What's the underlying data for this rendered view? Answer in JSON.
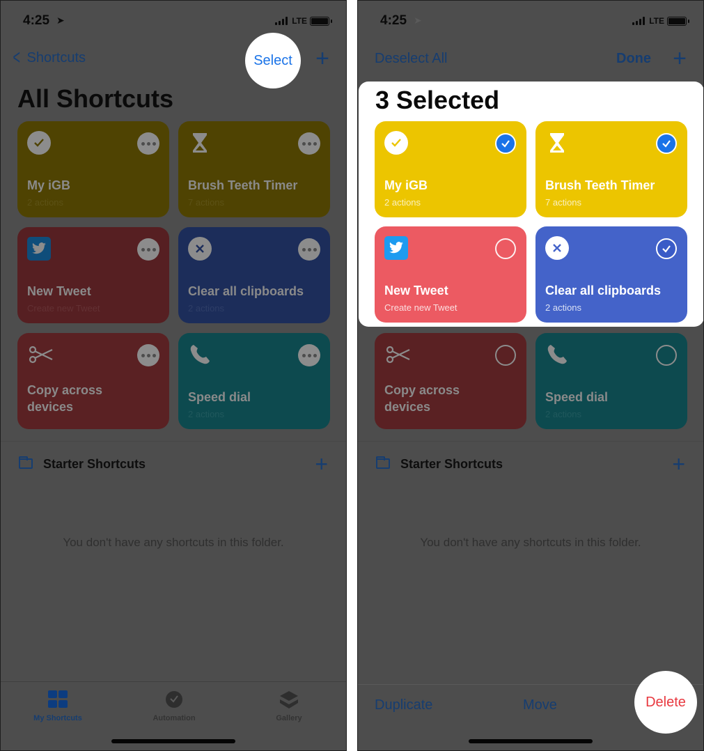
{
  "colors": {
    "yellow": "#ecc500",
    "yellow_dim": "#4f4302",
    "red": "#ec5a62",
    "red_dim": "#561f22",
    "darkred_dim": "#5a2123",
    "blue": "#4463c9",
    "blue_dim": "#1c2d5a",
    "teal_dim": "#0d4a4f",
    "ios_blue": "#1a73e8",
    "delete_red": "#e8383f"
  },
  "left": {
    "status": {
      "time": "4:25",
      "network": "LTE"
    },
    "nav": {
      "back_label": "Shortcuts",
      "select_label": "Select",
      "add_label": "+"
    },
    "title": "All Shortcuts",
    "shortcuts": [
      {
        "name": "My iGB",
        "subtitle": "2 actions",
        "icon": "checkmark-icon"
      },
      {
        "name": "Brush Teeth Timer",
        "subtitle": "7 actions",
        "icon": "hourglass-icon"
      },
      {
        "name": "New Tweet",
        "subtitle": "Create new Tweet",
        "icon": "twitter-icon"
      },
      {
        "name": "Clear all clipboards",
        "subtitle": "2 actions",
        "icon": "x-mark-icon"
      },
      {
        "name": "Copy across devices",
        "subtitle": "",
        "icon": "scissors-icon"
      },
      {
        "name": "Speed dial",
        "subtitle": "2 actions",
        "icon": "phone-icon"
      }
    ],
    "folder": {
      "name": "Starter Shortcuts",
      "add_label": "+"
    },
    "empty_message": "You don't have any shortcuts in this folder.",
    "tabs": [
      {
        "label": "My Shortcuts",
        "icon": "grid-icon",
        "active": true
      },
      {
        "label": "Automation",
        "icon": "clock-check-icon",
        "active": false
      },
      {
        "label": "Gallery",
        "icon": "layers-icon",
        "active": false
      }
    ]
  },
  "right": {
    "status": {
      "time": "4:25",
      "network": "LTE"
    },
    "nav": {
      "deselect_label": "Deselect All",
      "done_label": "Done",
      "add_label": "+"
    },
    "title": "3 Selected",
    "shortcuts": [
      {
        "name": "My iGB",
        "subtitle": "2 actions",
        "icon": "checkmark-icon",
        "selected": true
      },
      {
        "name": "Brush Teeth Timer",
        "subtitle": "7 actions",
        "icon": "hourglass-icon",
        "selected": true
      },
      {
        "name": "New Tweet",
        "subtitle": "Create new Tweet",
        "icon": "twitter-icon",
        "selected": false
      },
      {
        "name": "Clear all clipboards",
        "subtitle": "2 actions",
        "icon": "x-mark-icon",
        "selected": true
      },
      {
        "name": "Copy across devices",
        "subtitle": "",
        "icon": "scissors-icon",
        "selected": false
      },
      {
        "name": "Speed dial",
        "subtitle": "2 actions",
        "icon": "phone-icon",
        "selected": false
      }
    ],
    "folder": {
      "name": "Starter Shortcuts",
      "add_label": "+"
    },
    "empty_message": "You don't have any shortcuts in this folder.",
    "actions": {
      "duplicate": "Duplicate",
      "move": "Move",
      "delete": "Delete"
    }
  }
}
